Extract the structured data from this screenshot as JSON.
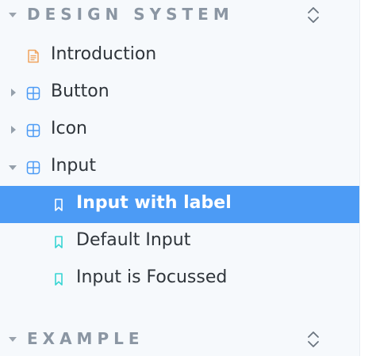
{
  "sections": [
    {
      "title": "DESIGN SYSTEM",
      "items": [
        {
          "label": "Introduction",
          "kind": "docs",
          "icon": "document-icon"
        },
        {
          "label": "Button",
          "kind": "component",
          "icon": "component-icon",
          "expanded": false
        },
        {
          "label": "Icon",
          "kind": "component",
          "icon": "component-icon",
          "expanded": false
        },
        {
          "label": "Input",
          "kind": "component",
          "icon": "component-icon",
          "expanded": true,
          "children": [
            {
              "label": "Input with label",
              "kind": "story",
              "icon": "bookmark-icon",
              "selected": true
            },
            {
              "label": "Default Input",
              "kind": "story",
              "icon": "bookmark-icon",
              "selected": false
            },
            {
              "label": "Input is Focussed",
              "kind": "story",
              "icon": "bookmark-icon",
              "selected": false
            }
          ]
        }
      ]
    },
    {
      "title": "EXAMPLE",
      "items": []
    }
  ],
  "colors": {
    "sidebar_bg": "#f6f9fc",
    "selected_bg": "#4c9bf5",
    "section_title": "#8b96a3",
    "doc_icon": "#f0a35c",
    "component_icon": "#4c9bf5",
    "story_icon": "#37d5d3"
  }
}
